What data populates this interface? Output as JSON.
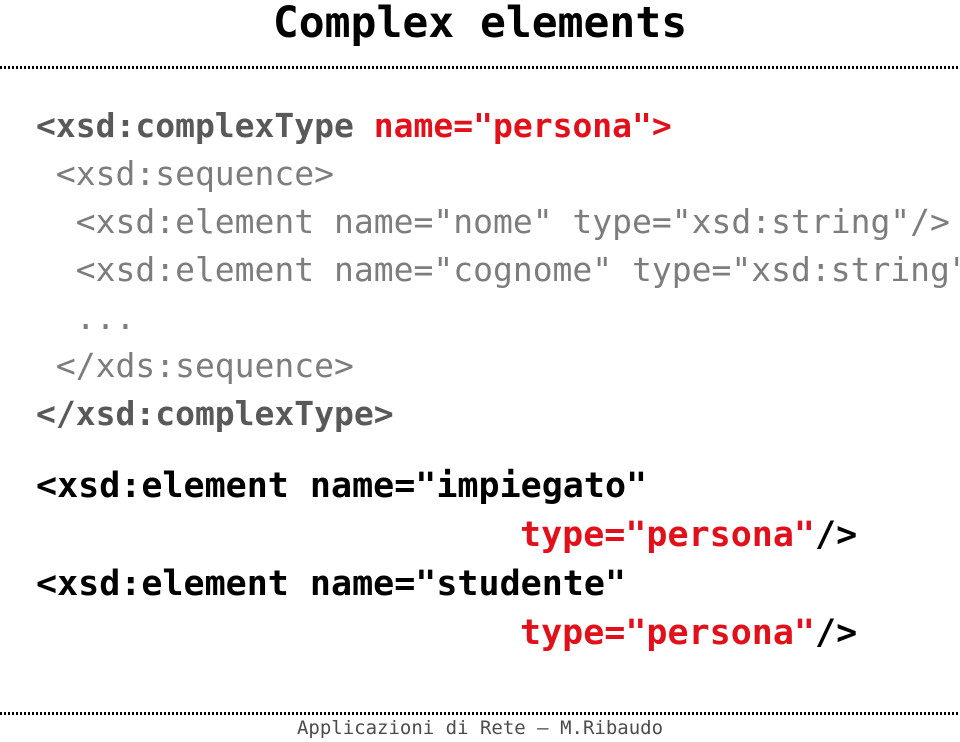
{
  "slide": {
    "title": "Complex elements",
    "footer": "Applicazioni di Rete – M.Ribaudo"
  },
  "colors": {
    "accent_red": "#e2101a",
    "code_dark": "#595959",
    "code_gray": "#7d7d7d",
    "code_black": "#000000",
    "footer_gray": "#4c4c4c",
    "background": "#ffffff"
  },
  "code_block_1": {
    "lines": [
      {
        "id": "line-complextype-open",
        "segments": [
          {
            "text": "<xsd:complexType ",
            "style": "dark-bold"
          },
          {
            "text": "name=\"persona\">",
            "style": "red-bold"
          }
        ]
      },
      {
        "id": "line-sequence-open",
        "segments": [
          {
            "text": " <xsd:sequence>",
            "style": "gray-normal"
          }
        ]
      },
      {
        "id": "line-element-nome",
        "segments": [
          {
            "text": "  <xsd:element name=\"nome\" type=\"xsd:string\"/>",
            "style": "gray-normal"
          }
        ]
      },
      {
        "id": "line-element-cognome",
        "segments": [
          {
            "text": "  <xsd:element name=\"cognome\" type=\"xsd:string\"/>",
            "style": "gray-normal"
          }
        ]
      },
      {
        "id": "line-ellipsis",
        "segments": [
          {
            "text": "  ...",
            "style": "gray-normal"
          }
        ]
      },
      {
        "id": "line-sequence-close",
        "segments": [
          {
            "text": " </xds:sequence>",
            "style": "gray-normal"
          }
        ]
      },
      {
        "id": "line-complextype-close",
        "segments": [
          {
            "text": "</xsd:complexType>",
            "style": "dark-bold"
          }
        ]
      }
    ]
  },
  "code_block_2": {
    "lines": [
      {
        "id": "line-element-impiegato",
        "indent": "left",
        "segments": [
          {
            "text": "<xsd:element name=\"impiegato\"",
            "style": "black-bold"
          }
        ]
      },
      {
        "id": "line-impiegato-type",
        "indent": "right",
        "segments": [
          {
            "text": "type=\"persona\"",
            "style": "red-bold"
          },
          {
            "text": "/>",
            "style": "black-bold"
          }
        ]
      },
      {
        "id": "line-element-studente",
        "indent": "left",
        "segments": [
          {
            "text": "<xsd:element name=\"studente\"",
            "style": "black-bold"
          }
        ]
      },
      {
        "id": "line-studente-type",
        "indent": "right",
        "segments": [
          {
            "text": "type=\"persona\"",
            "style": "red-bold"
          },
          {
            "text": "/>",
            "style": "black-bold"
          }
        ]
      }
    ]
  }
}
